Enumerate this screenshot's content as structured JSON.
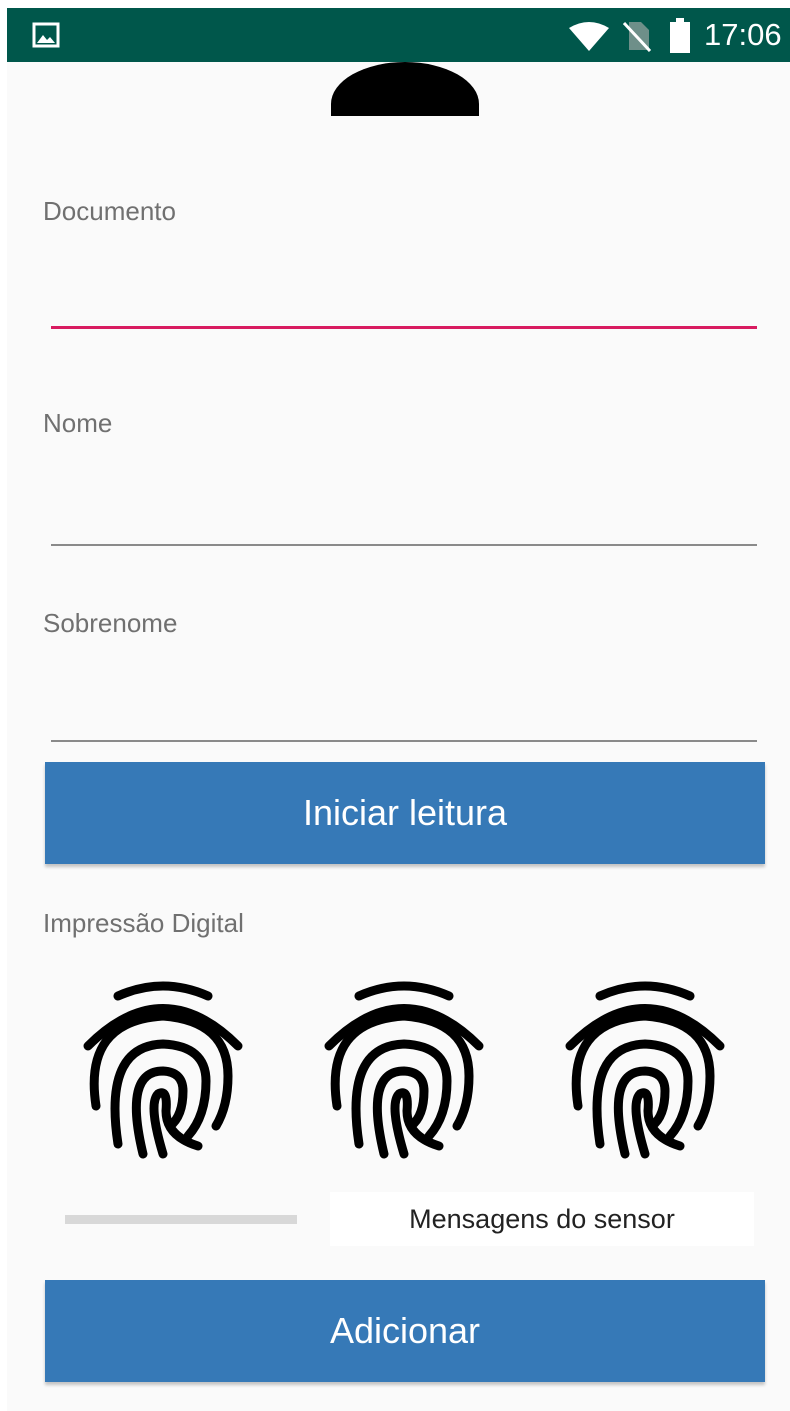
{
  "status_bar": {
    "time": "17:06",
    "icons": [
      "image-notification-icon",
      "wifi-icon",
      "no-sim-icon",
      "battery-icon"
    ],
    "background_color": "#00574b"
  },
  "form": {
    "documento": {
      "label": "Documento",
      "value": ""
    },
    "nome": {
      "label": "Nome",
      "value": ""
    },
    "sobrenome": {
      "label": "Sobrenome",
      "value": ""
    }
  },
  "buttons": {
    "start_reading": "Iniciar leitura",
    "add": "Adicionar",
    "color": "#3679b7"
  },
  "fingerprint": {
    "section_label": "Impressão Digital",
    "icons": [
      "fingerprint-icon",
      "fingerprint-icon",
      "fingerprint-icon"
    ]
  },
  "sensor": {
    "message": "Mensagens do sensor",
    "progress": 0
  },
  "accent_color": "#d81b60"
}
